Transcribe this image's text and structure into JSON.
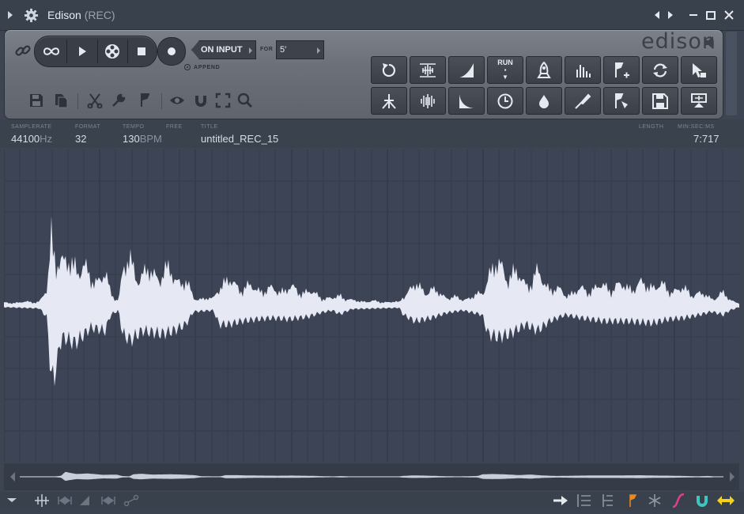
{
  "window": {
    "title": "Edison",
    "mode": "(REC)"
  },
  "toolbar": {
    "record_source": "ON INPUT",
    "for_label": "FOR",
    "duration": "5'",
    "append_label": "APPEND",
    "logo": "edison",
    "run_label": "RUN"
  },
  "info": {
    "samplerate_label": "SAMPLERATE",
    "samplerate": "44100",
    "samplerate_unit": "Hz",
    "format_label": "FORMAT",
    "format": "32",
    "tempo_label": "TEMPO",
    "tempo": "130",
    "tempo_unit": "BPM",
    "free_label": "FREE",
    "title_label": "TITLE",
    "title": "untitled_REC_15",
    "length_label": "LENGTH",
    "length_unit_label": "MIN:SEC:MS",
    "length": "7:717"
  },
  "colors": {
    "waveform": "#e6e9f4",
    "background": "#3c4455",
    "panel": "#6b7079",
    "accent_pink": "#e0408a",
    "accent_yellow": "#f2d21b",
    "accent_teal": "#3ec5c0",
    "accent_orange": "#e88a1e"
  }
}
